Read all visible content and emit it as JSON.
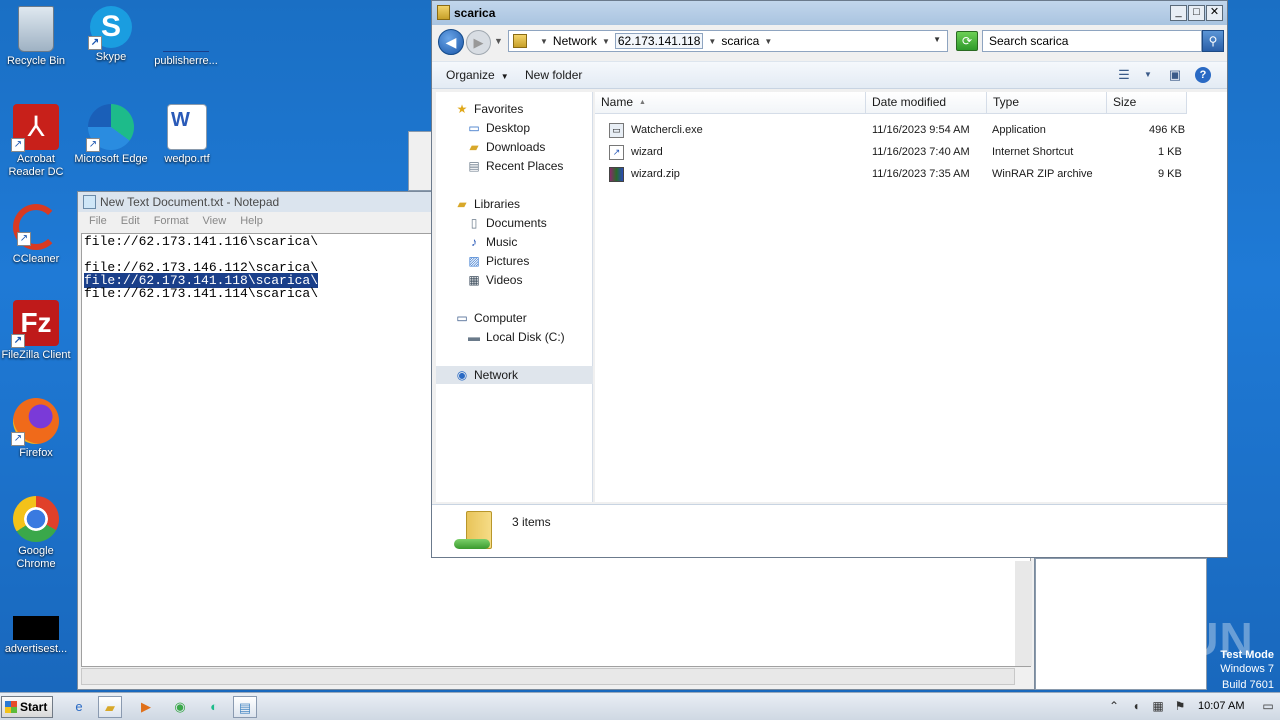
{
  "desktop": {
    "icons": [
      {
        "label": "Recycle Bin"
      },
      {
        "label": "Skype"
      },
      {
        "label": "publisherre..."
      },
      {
        "label": "Acrobat Reader DC"
      },
      {
        "label": "Microsoft Edge"
      },
      {
        "label": "wedpo.rtf"
      },
      {
        "label": "CCleaner"
      },
      {
        "label": "FileZilla Client"
      },
      {
        "label": "Firefox"
      },
      {
        "label": "Google Chrome"
      },
      {
        "label": "advertisest..."
      }
    ],
    "watermark": "ANY RUN",
    "test_mode": {
      "line1": "Test Mode",
      "line2": "Windows 7",
      "line3": "Build 7601"
    }
  },
  "notepad": {
    "title": "New Text Document.txt - Notepad",
    "menu": [
      "File",
      "Edit",
      "Format",
      "View",
      "Help"
    ],
    "lines": [
      "file://62.173.141.116\\scarica\\",
      "",
      "file://62.173.146.112\\scarica\\",
      "file://62.173.141.118\\scarica\\",
      "file://62.173.141.114\\scarica\\"
    ],
    "selected_line_index": 3
  },
  "explorer": {
    "title": "scarica",
    "address": {
      "crumbs": [
        "Network",
        "62.173.141.118",
        "scarica"
      ]
    },
    "search_placeholder": "Search scarica",
    "toolbar": {
      "organize": "Organize",
      "new_folder": "New folder"
    },
    "nav": {
      "favorites": "Favorites",
      "desktop": "Desktop",
      "downloads": "Downloads",
      "recent": "Recent Places",
      "libraries": "Libraries",
      "documents": "Documents",
      "music": "Music",
      "pictures": "Pictures",
      "videos": "Videos",
      "computer": "Computer",
      "local_disk": "Local Disk (C:)",
      "network": "Network"
    },
    "columns": {
      "name": "Name",
      "date": "Date modified",
      "type": "Type",
      "size": "Size"
    },
    "files": [
      {
        "name": "Watchercli.exe",
        "date": "11/16/2023 9:54 AM",
        "type": "Application",
        "size": "496 KB"
      },
      {
        "name": "wizard",
        "date": "11/16/2023 7:40 AM",
        "type": "Internet Shortcut",
        "size": "1 KB"
      },
      {
        "name": "wizard.zip",
        "date": "11/16/2023 7:35 AM",
        "type": "WinRAR ZIP archive",
        "size": "9 KB"
      }
    ],
    "status": "3 items"
  },
  "taskbar": {
    "start_label": "Start",
    "clock": "10:07 AM"
  }
}
